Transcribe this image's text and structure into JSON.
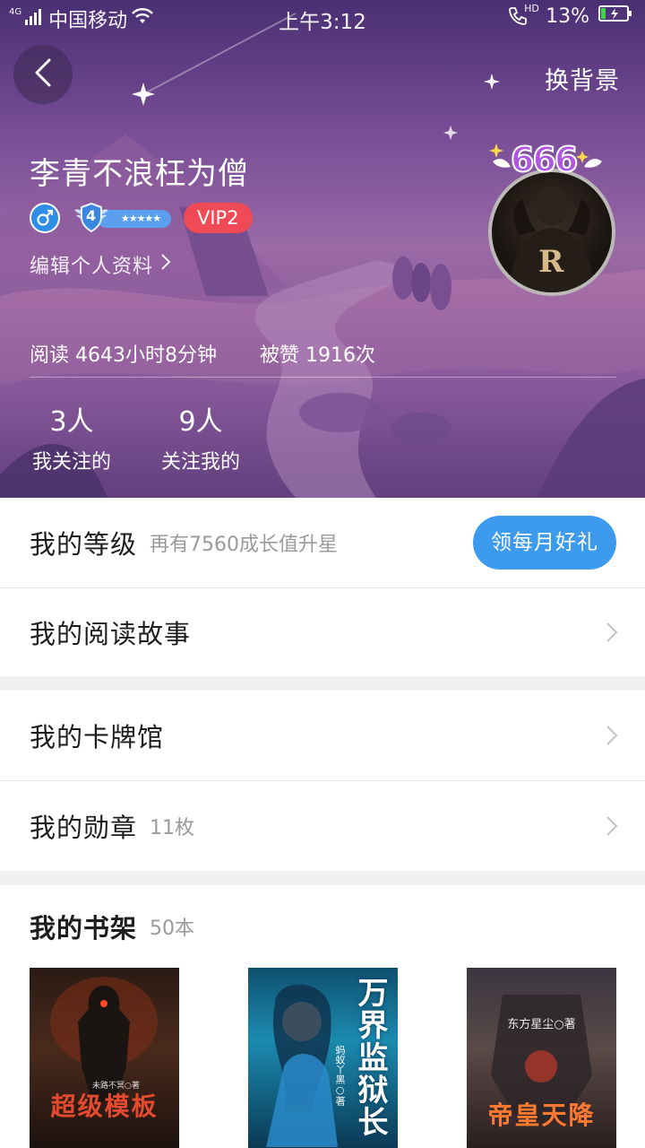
{
  "status_bar": {
    "network": "4G",
    "carrier": "中国移动",
    "time": "上午3:12",
    "call_hd": "HD",
    "battery_percent": "13%"
  },
  "header": {
    "change_background_label": "换背景"
  },
  "profile": {
    "username": "李青不浪枉为僧",
    "gender": "male",
    "level_number": "4",
    "level_stars": "★★★★★",
    "vip_label": "VIP2",
    "edit_profile_label": "编辑个人资料",
    "avatar_badge_text": "666",
    "avatar_letter": "R"
  },
  "stats": {
    "reading_label": "阅读",
    "reading_value": "4643小时8分钟",
    "likes_label": "被赞",
    "likes_value": "1916次",
    "following_count": "3人",
    "following_label": "我关注的",
    "followers_count": "9人",
    "followers_label": "关注我的"
  },
  "menu": {
    "level": {
      "title": "我的等级",
      "subtitle": "再有7560成长值升星",
      "button": "领每月好礼"
    },
    "reading_story": {
      "title": "我的阅读故事"
    },
    "card_hall": {
      "title": "我的卡牌馆"
    },
    "medals": {
      "title": "我的勋章",
      "count": "11枚"
    }
  },
  "bookshelf": {
    "title": "我的书架",
    "count": "50本",
    "books": [
      {
        "title": "超级模板",
        "author": "未路不冥○著",
        "accent": "#c33b2a"
      },
      {
        "title": "万界监狱长",
        "author": "蚂蚁丫黑○著",
        "accent": "#2fb0d8"
      },
      {
        "title": "帝皇天降",
        "author": "东方星尘○著",
        "accent": "#e0402a"
      }
    ]
  },
  "colors": {
    "accent_blue": "#3d9bee",
    "vip_red": "#ef4a55",
    "hero_purple": "#7a4f98"
  }
}
